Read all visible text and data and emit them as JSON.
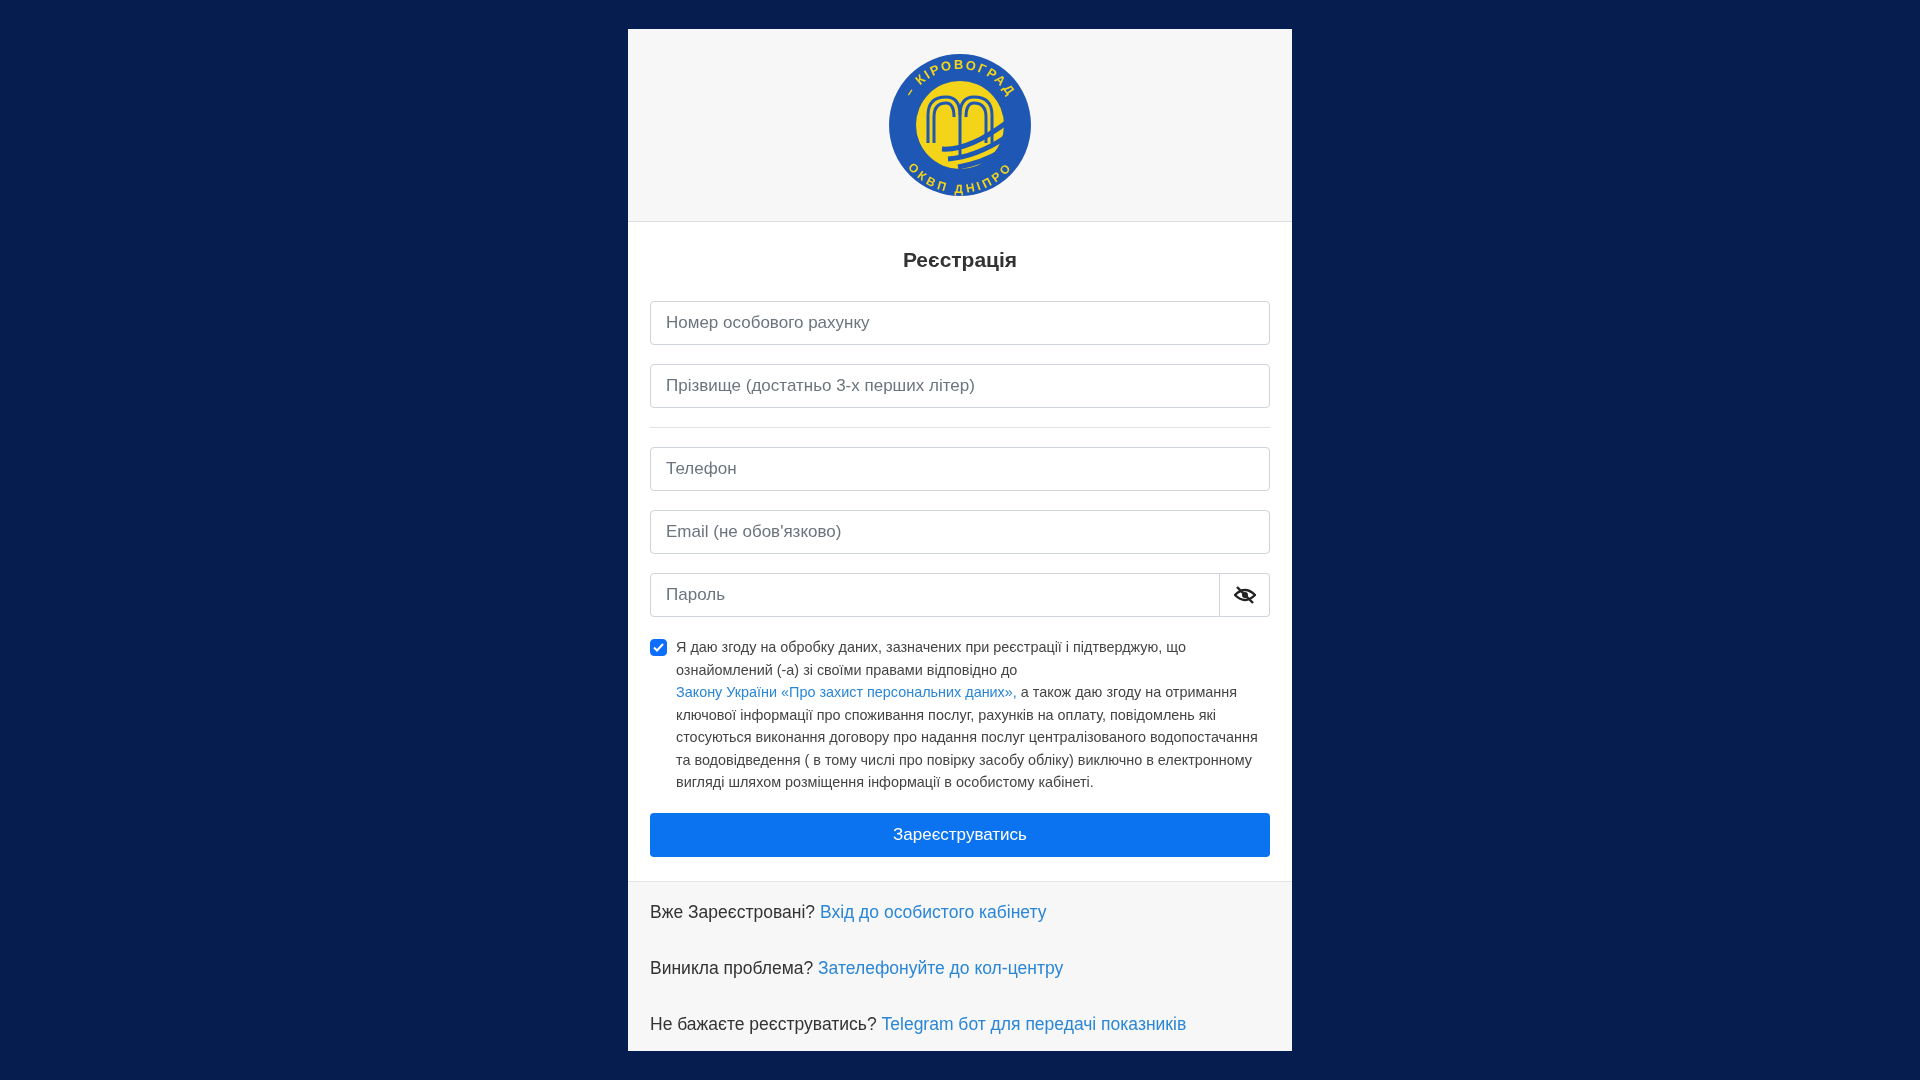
{
  "logo": {
    "top_text": "– КІРОВОГРАД",
    "bottom_text": "ОКВП ДНІПРО"
  },
  "title": "Реєстрація",
  "fields": [
    {
      "kind": "text",
      "placeholder": "Номер особового рахунку"
    },
    {
      "kind": "text",
      "placeholder": "Прізвище (достатньо 3-х перших літер)"
    },
    {
      "kind": "divider"
    },
    {
      "kind": "text",
      "placeholder": "Телефон"
    },
    {
      "kind": "text",
      "placeholder": "Email (не обов'язково)"
    },
    {
      "kind": "password",
      "placeholder": "Пароль"
    }
  ],
  "consent": {
    "checked": true,
    "text_before": "Я даю згоду на обробку даних, зазначених при реєстрації і підтверджую, що ознайомлений (-а) зі своїми правами відповідно до",
    "link": "Закону України «Про захист персональних даних»,",
    "text_after": "а також даю згоду на отримання ключової інформації про споживання послуг, рахунків на оплату, повідомлень які стосуються виконання договору про надання послуг централізованого водопостачання та водовідведення ( в тому числі про повірку засобу обліку) виключно в електронному вигляді шляхом розміщення інформації в особистому кабінеті."
  },
  "submit": "Зареєструватись",
  "footer": [
    {
      "question": "Вже Зареєстровані?",
      "link": "Вхід до особистого кабінету"
    },
    {
      "question": "Виникла проблема?",
      "link": "Зателефонуйте до кол-центру"
    },
    {
      "question": "Не бажаєте реєструватись?",
      "link": "Telegram бот для передачі показників"
    }
  ]
}
